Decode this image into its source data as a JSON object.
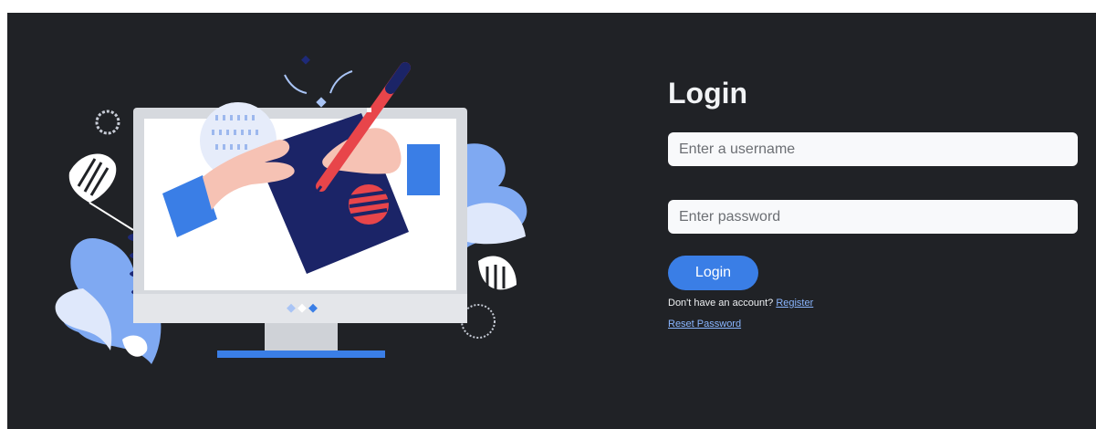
{
  "login": {
    "title": "Login",
    "username_placeholder": "Enter a username",
    "password_placeholder": "Enter password",
    "submit_label": "Login",
    "signup_prompt": "Don't have an account?",
    "register_link": "Register",
    "reset_link": "Reset Password"
  },
  "colors": {
    "panel_background": "#202226",
    "button": "#3a7ee6",
    "link": "#8ab6ff",
    "title": "#f1f3f5"
  },
  "illustration": {
    "icon": "computer-design-illustration"
  }
}
